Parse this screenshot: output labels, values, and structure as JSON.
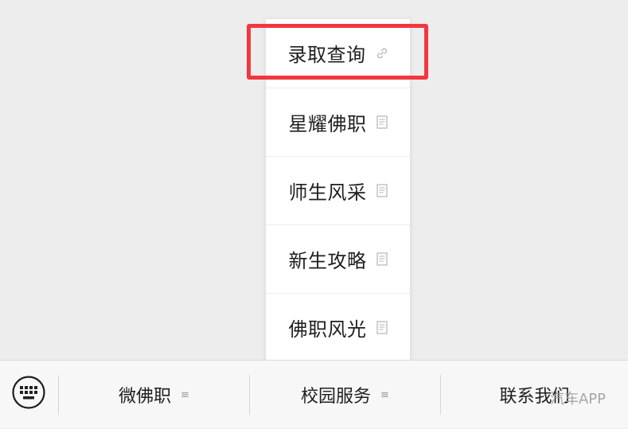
{
  "popup_menu": {
    "items": [
      {
        "label": "录取查询",
        "icon": "link-icon"
      },
      {
        "label": "星耀佛职",
        "icon": "article-icon"
      },
      {
        "label": "师生风采",
        "icon": "article-icon"
      },
      {
        "label": "新生攻略",
        "icon": "article-icon"
      },
      {
        "label": "佛职风光",
        "icon": "article-icon"
      }
    ],
    "highlight_color": "#f2373e"
  },
  "bottom_bar": {
    "keyboard_icon": "keyboard-icon",
    "tabs": [
      {
        "label": "微佛职",
        "menu_icon": "≡"
      },
      {
        "label": "校园服务",
        "menu_icon": "≡"
      },
      {
        "label": "联系我们",
        "menu_icon": ""
      }
    ]
  },
  "watermark": {
    "text": "汽车APP"
  }
}
